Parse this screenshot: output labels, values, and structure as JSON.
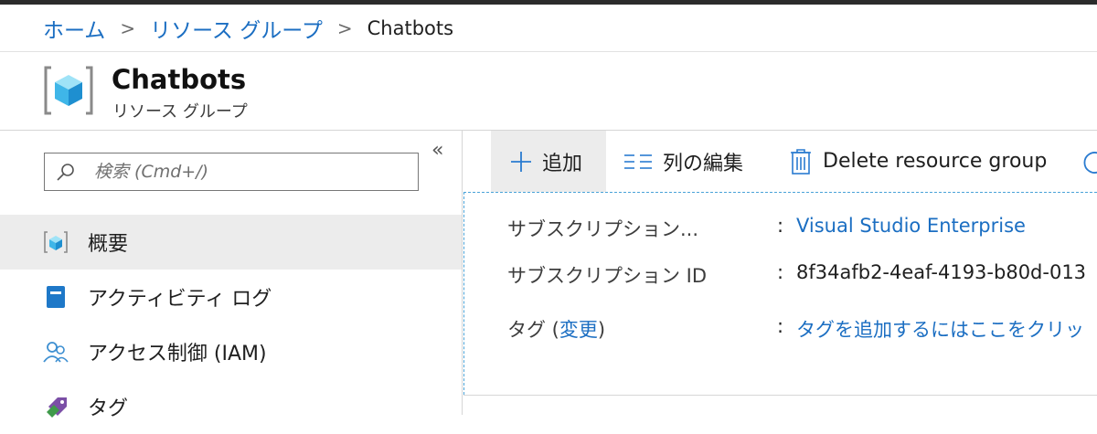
{
  "breadcrumb": {
    "items": [
      "ホーム",
      "リソース グループ"
    ],
    "current": "Chatbots"
  },
  "header": {
    "title": "Chatbots",
    "subtitle": "リソース グループ"
  },
  "sidebar": {
    "search_placeholder": "検索 (Cmd+/)",
    "collapse_glyph": "«",
    "items": [
      {
        "label": "概要",
        "icon": "resource-group-icon",
        "active": true
      },
      {
        "label": "アクティビティ ログ",
        "icon": "activity-log-icon"
      },
      {
        "label": "アクセス制御 (IAM)",
        "icon": "people-icon"
      },
      {
        "label": "タグ",
        "icon": "tag-icon"
      }
    ]
  },
  "toolbar": {
    "add_label": "追加",
    "columns_label": "列の編集",
    "delete_label": "Delete resource group"
  },
  "essentials": {
    "subscription_label": "サブスクリプション...",
    "subscription_value": "Visual Studio Enterprise",
    "subscription_id_label": "サブスクリプション ID",
    "subscription_id_value": "8f34afb2-4eaf-4193-b80d-013",
    "tags_label_prefix": "タグ (",
    "tags_change_link": "変更",
    "tags_label_suffix": ")",
    "tags_value": "タグを追加するにはここをクリッ",
    "colon": ":"
  },
  "colors": {
    "link": "#1b6ec2",
    "accent_dashed": "#4aa3d8",
    "active_bg": "#ececec"
  }
}
